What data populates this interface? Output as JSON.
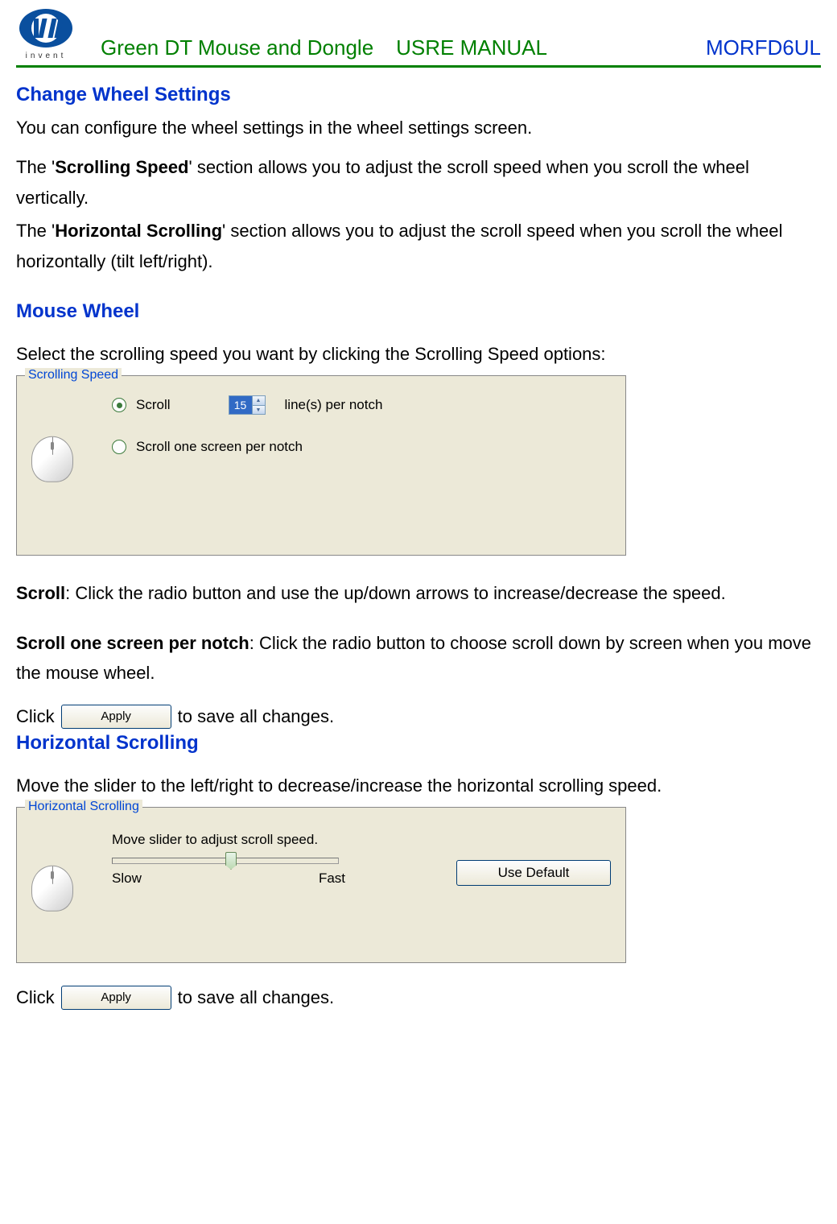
{
  "header": {
    "brand_sub": "i n v e n t",
    "title1": "Green DT Mouse and Dongle",
    "title2": "USRE MANUAL",
    "title3": "MORFD6UL"
  },
  "sections": {
    "change_wheel": {
      "heading": "Change Wheel Settings",
      "intro": "You can configure the wheel settings in the wheel settings screen.",
      "para2_prefix": "The '",
      "para2_bold": "Scrolling Speed",
      "para2_suffix": "' section allows you to adjust the scroll speed when you scroll the wheel vertically.",
      "para3_prefix": "The '",
      "para3_bold": "Horizontal Scrolling",
      "para3_suffix": "' section allows you to adjust the scroll speed when you scroll the wheel horizontally (tilt left/right)."
    },
    "mouse_wheel": {
      "heading": "Mouse Wheel",
      "intro": "Select the scrolling speed you want by clicking the Scrolling Speed options:",
      "panel_legend": "Scrolling Speed",
      "radio1": "Scroll",
      "spinner_value": "15",
      "spinner_suffix": "line(s) per notch",
      "radio2": "Scroll one screen per notch",
      "desc1_bold": "Scroll",
      "desc1_rest": ": Click the radio button and use the up/down arrows to increase/decrease the speed.",
      "desc2_bold": "Scroll one screen per notch",
      "desc2_rest": ": Click the radio button to choose scroll down by screen when you move the mouse wheel.",
      "click_prefix": "Click",
      "apply_label": "Apply",
      "click_suffix": " to save all changes."
    },
    "horizontal_scrolling": {
      "heading": "Horizontal Scrolling",
      "intro": "Move the slider to the left/right to decrease/increase the horizontal scrolling speed.",
      "panel_legend": "Horizontal Scrolling",
      "slider_instruction": "Move slider to adjust scroll speed.",
      "slow_label": "Slow",
      "fast_label": "Fast",
      "use_default": "Use Default",
      "click_prefix": "Click",
      "apply_label": "Apply",
      "click_suffix": "to save all changes."
    }
  }
}
